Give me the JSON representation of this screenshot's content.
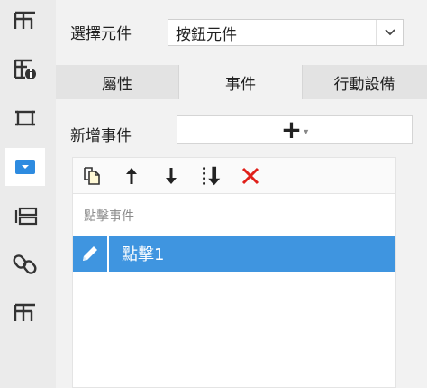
{
  "rail": {
    "icons": [
      "table-icon",
      "table-info-icon",
      "frame-icon",
      "dropdown-icon",
      "layout-icon",
      "link-icon",
      "table-icon"
    ]
  },
  "select_component": {
    "label": "選擇元件",
    "value": "按鈕元件"
  },
  "tabs": [
    {
      "label": "屬性",
      "active": false
    },
    {
      "label": "事件",
      "active": true
    },
    {
      "label": "行動設備",
      "active": false
    }
  ],
  "add_event": {
    "label": "新增事件",
    "button_glyph": "+",
    "caret_glyph": "▾"
  },
  "toolbar": {
    "icons": [
      "copy-icon",
      "arrow-up-icon",
      "arrow-down-icon",
      "move-to-bottom-icon",
      "delete-icon"
    ]
  },
  "events_list": {
    "header": "點擊事件",
    "rows": [
      {
        "label": "點擊1",
        "icon": "edit-icon",
        "selected": true
      }
    ]
  },
  "colors": {
    "selected_row": "#3f95e0",
    "delete": "#e0201a",
    "accent_blue": "#2d8be0"
  }
}
